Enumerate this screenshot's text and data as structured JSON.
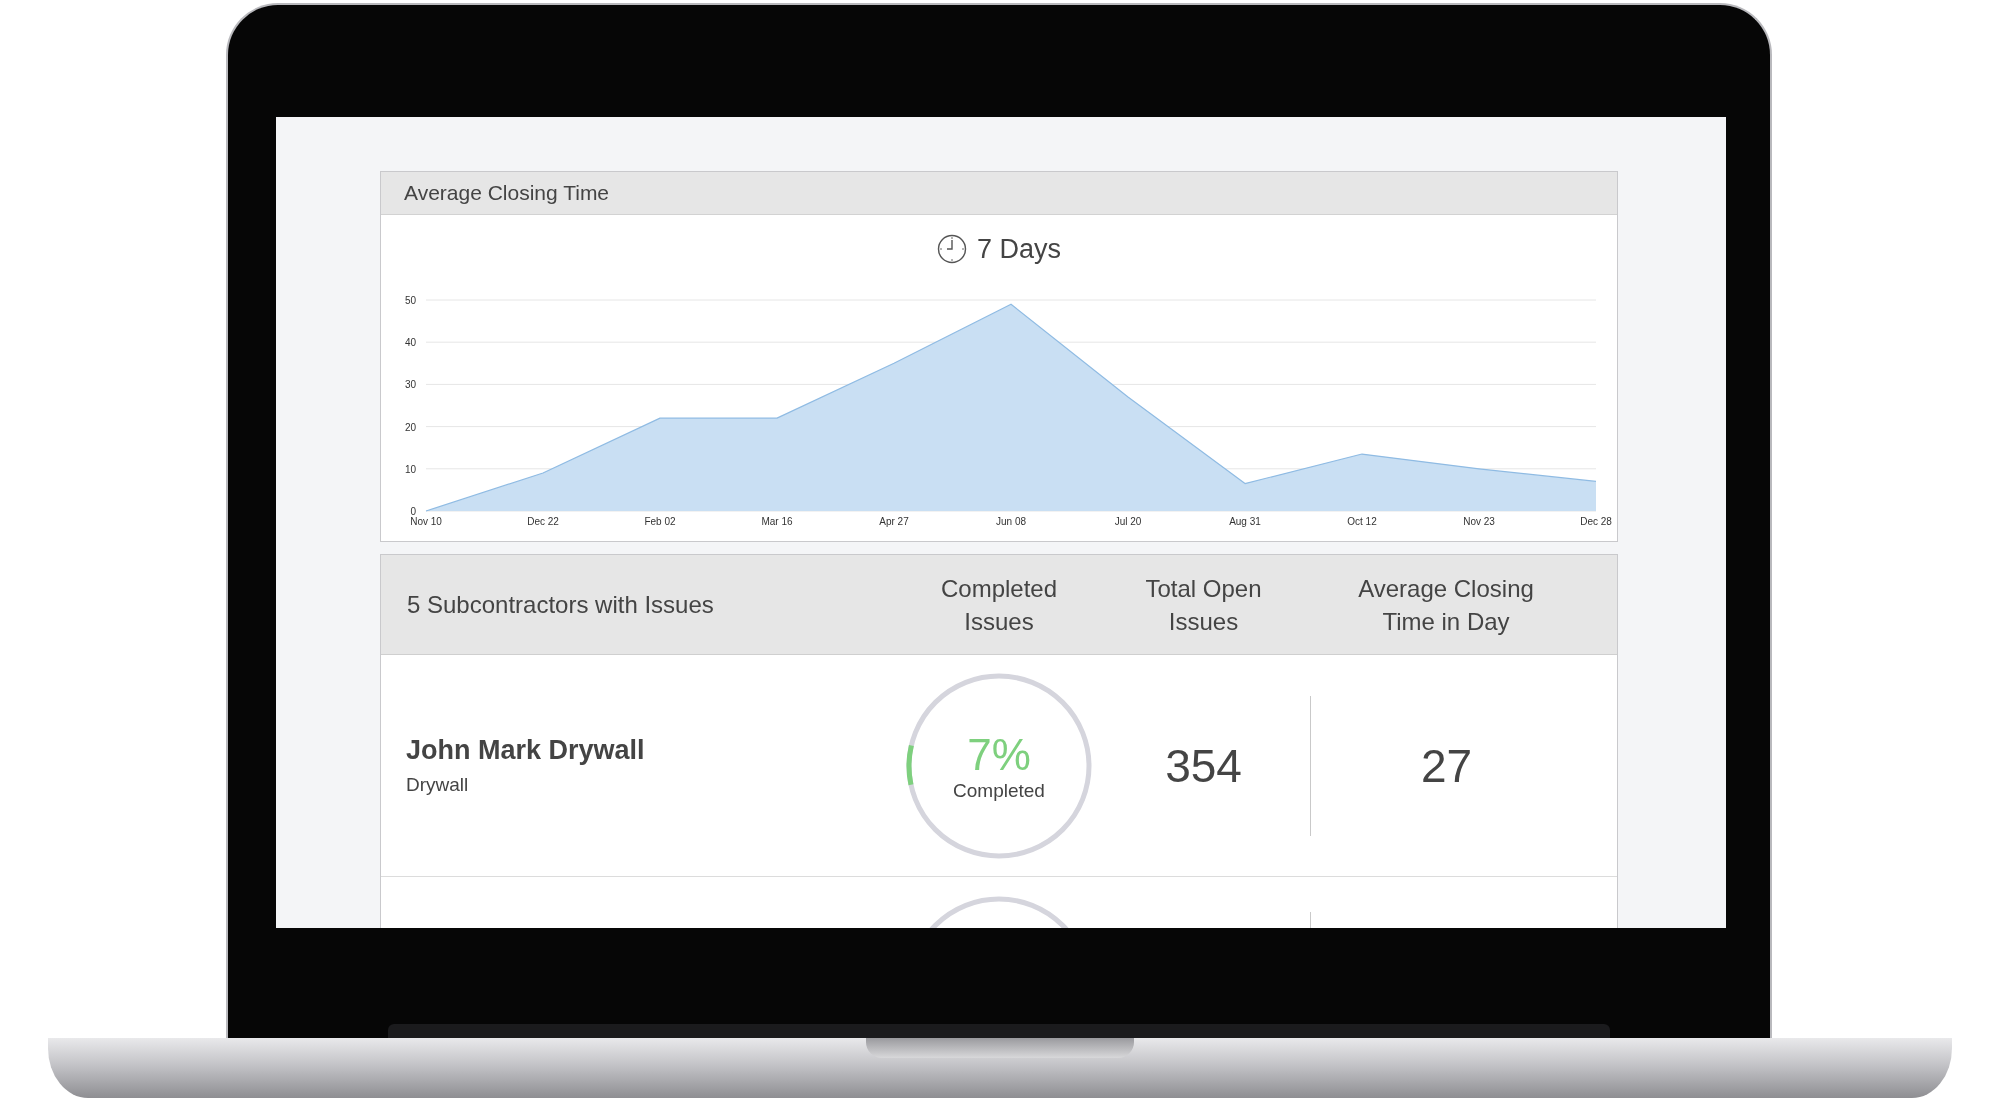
{
  "chart_panel": {
    "title": "Average Closing Time",
    "summary": "7 Days",
    "chart_data": {
      "type": "area",
      "categories": [
        "Nov 10",
        "Dec 22",
        "Feb 02",
        "Mar 16",
        "Apr 27",
        "Jun 08",
        "Jul 20",
        "Aug 31",
        "Oct 12",
        "Nov 23",
        "Dec 28"
      ],
      "series": [
        {
          "color": "#c9dff3",
          "values": [
            0,
            9,
            22,
            22,
            35,
            49,
            27,
            6.5,
            13.5,
            10,
            7
          ]
        }
      ],
      "ylim": [
        0,
        50
      ],
      "grid": true,
      "yticks": [
        0,
        10,
        20,
        30,
        40,
        50
      ]
    }
  },
  "table": {
    "columns": [
      "5 Subcontractors with Issues",
      "Completed Issues",
      "Total Open Issues",
      "Average Closing Time in Day"
    ],
    "rows": [
      {
        "kind": "full",
        "name": "John Mark Drywall",
        "trade": "Drywall",
        "percent": "7%",
        "level": 0.07,
        "progress_label": "Completed",
        "total_open": "354",
        "avg_closing": "27"
      },
      {
        "kind": "cut"
      }
    ]
  }
}
